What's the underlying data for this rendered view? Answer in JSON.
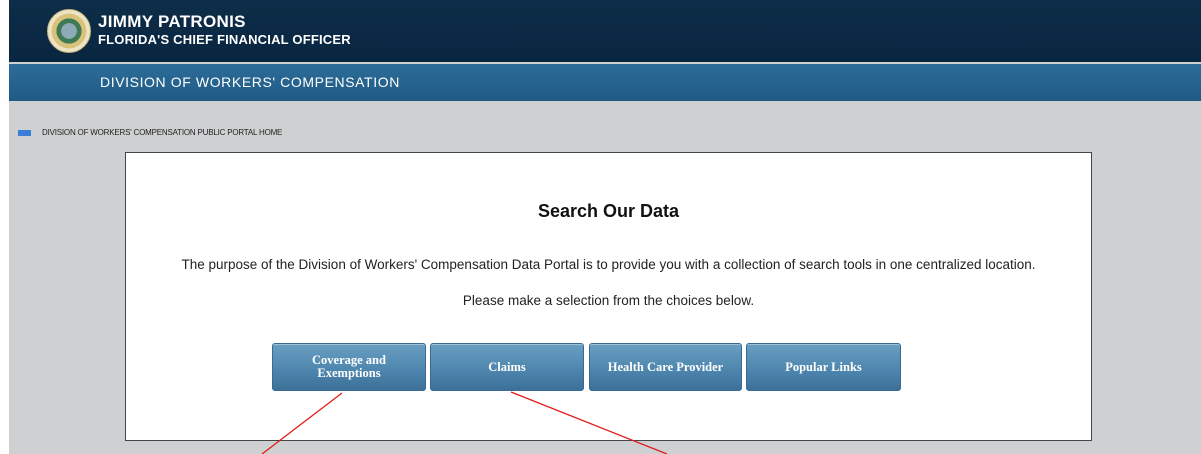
{
  "header": {
    "official_name": "JIMMY PATRONIS",
    "official_title": "FLORIDA'S CHIEF FINANCIAL OFFICER",
    "division": "DIVISION OF WORKERS' COMPENSATION"
  },
  "breadcrumb": {
    "home_label": "DIVISION OF WORKERS' COMPENSATION PUBLIC PORTAL HOME"
  },
  "main": {
    "title": "Search Our Data",
    "intro": "The purpose of the Division of Workers' Compensation Data Portal is to provide you with a collection of search tools in one centralized location.",
    "prompt": "Please make a selection from the choices below.",
    "buttons": [
      {
        "label": "Coverage and Exemptions"
      },
      {
        "label": "Claims"
      },
      {
        "label": "Health Care Provider"
      },
      {
        "label": "Popular Links"
      }
    ]
  },
  "colors": {
    "header_bg": "#0e2d48",
    "division_bar": "#2d6d99",
    "button": "#5a90b6",
    "annotation": "#e01b1b"
  }
}
